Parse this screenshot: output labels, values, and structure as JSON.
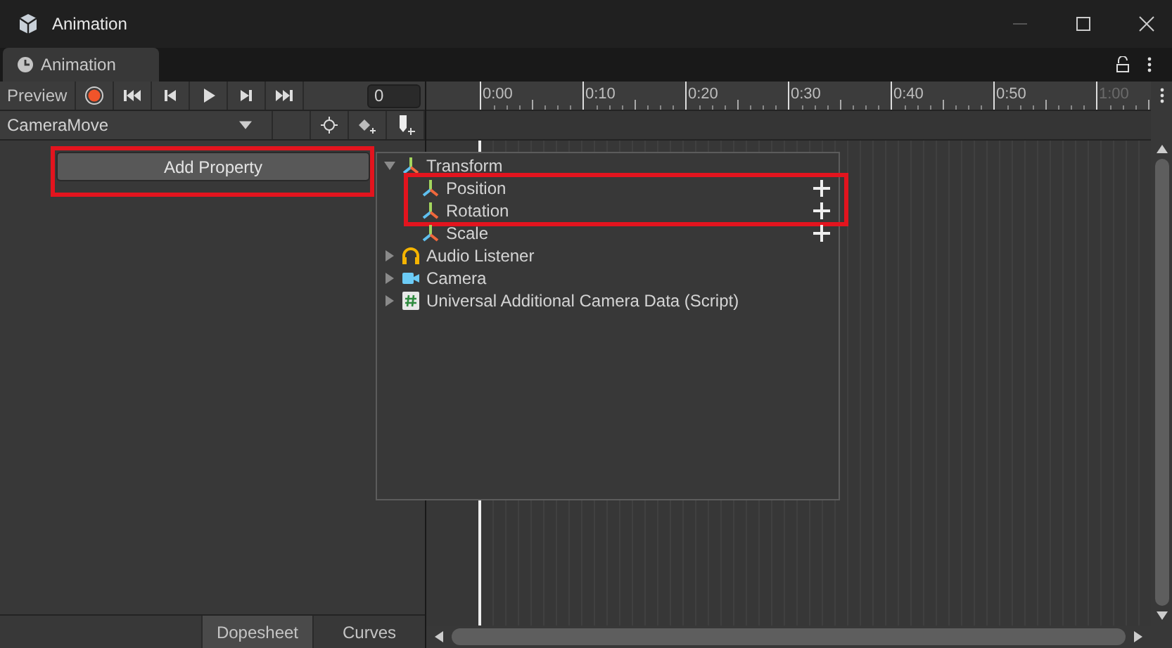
{
  "window": {
    "title": "Animation"
  },
  "tabs": [
    {
      "label": "Animation",
      "selected": true
    }
  ],
  "toolbar": {
    "preview": "Preview",
    "frame": "0"
  },
  "clip": {
    "name": "CameraMove"
  },
  "add_property": "Add Property",
  "ruler": [
    {
      "label": "0:00",
      "dimmed": false
    },
    {
      "label": "0:10",
      "dimmed": false
    },
    {
      "label": "0:20",
      "dimmed": false
    },
    {
      "label": "0:30",
      "dimmed": false
    },
    {
      "label": "0:40",
      "dimmed": false
    },
    {
      "label": "0:50",
      "dimmed": false
    },
    {
      "label": "1:00",
      "dimmed": true
    }
  ],
  "property_popup": {
    "items": [
      {
        "label": "Transform",
        "kind": "transform",
        "expanded": true,
        "children": [
          {
            "label": "Position",
            "highlighted": true
          },
          {
            "label": "Rotation",
            "highlighted": true
          },
          {
            "label": "Scale",
            "highlighted": false
          }
        ]
      },
      {
        "label": "Audio Listener",
        "kind": "audio",
        "expanded": false
      },
      {
        "label": "Camera",
        "kind": "camera",
        "expanded": false
      },
      {
        "label": "Universal Additional Camera Data (Script)",
        "kind": "script",
        "expanded": false
      }
    ]
  },
  "add_property_highlighted": true,
  "bottom_tabs": [
    {
      "label": "Dopesheet",
      "selected": true
    },
    {
      "label": "Curves",
      "selected": false
    }
  ]
}
